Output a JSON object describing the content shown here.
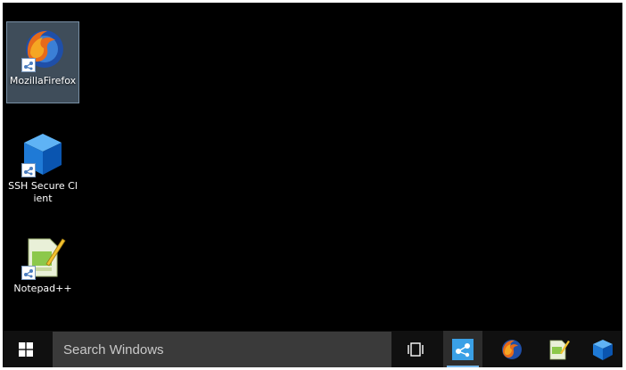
{
  "desktop": {
    "icons": [
      {
        "label": "MozillaFirefox",
        "icon": "firefox-icon",
        "selected": true
      },
      {
        "label": "SSH Secure Client",
        "icon": "ssh-cube-icon",
        "selected": false
      },
      {
        "label": "Notepad++",
        "icon": "notepadpp-icon",
        "selected": false
      }
    ]
  },
  "taskbar": {
    "start_icon": "windows-logo-icon",
    "search_placeholder": "Search Windows",
    "buttons": [
      {
        "name": "task-view-button",
        "icon": "task-view-icon",
        "active": false
      },
      {
        "name": "remote-app-button",
        "icon": "remote-share-icon",
        "active": true
      },
      {
        "name": "firefox-taskbar-button",
        "icon": "firefox-icon",
        "active": false
      },
      {
        "name": "notepadpp-taskbar-button",
        "icon": "notepadpp-icon",
        "active": false
      },
      {
        "name": "ssh-taskbar-button",
        "icon": "ssh-cube-icon",
        "active": false
      }
    ]
  },
  "colors": {
    "desktop_bg": "#000000",
    "taskbar_bg": "#101010",
    "search_bg": "#3a3a3a",
    "selection": "#8caac8",
    "accent": "#76b9ed"
  }
}
